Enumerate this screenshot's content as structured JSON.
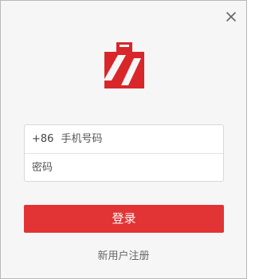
{
  "window": {
    "close_icon": "close-icon"
  },
  "logo": {
    "icon": "brand-logo",
    "color": "#d9262b"
  },
  "login_form": {
    "phone": {
      "country_code": "+86",
      "placeholder": "手机号码",
      "value": ""
    },
    "password": {
      "placeholder": "密码",
      "value": ""
    },
    "login_button_label": "登录",
    "register_link_label": "新用户注册"
  },
  "colors": {
    "accent": "#e23434",
    "background": "#f6f6f6",
    "border": "#d8d8d8"
  }
}
